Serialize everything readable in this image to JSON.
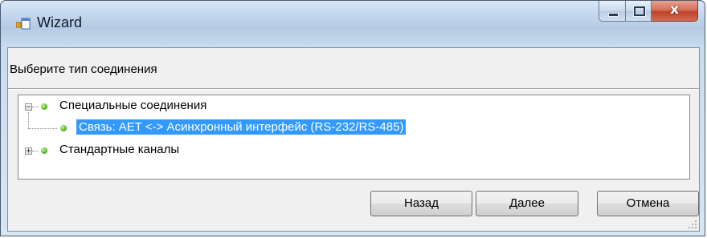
{
  "window": {
    "title": "Wizard",
    "close_glyph": "x"
  },
  "prompt": "Выберите тип соединения",
  "tree": {
    "nodes": [
      {
        "label": "Специальные соединения",
        "expander": "−",
        "icon": "green-dot-icon"
      },
      {
        "label": "Связь: AET <-> Асинхронный интерфейс (RS-232/RS-485)",
        "icon": "green-dot-icon",
        "selected": true
      },
      {
        "label": "Стандартные каналы",
        "expander": "+",
        "icon": "green-dot-icon"
      }
    ]
  },
  "buttons": {
    "back": "Назад",
    "next": "Далее",
    "cancel": "Отмена"
  },
  "colors": {
    "selection": "#3399ff",
    "close_button": "#c0422a"
  }
}
